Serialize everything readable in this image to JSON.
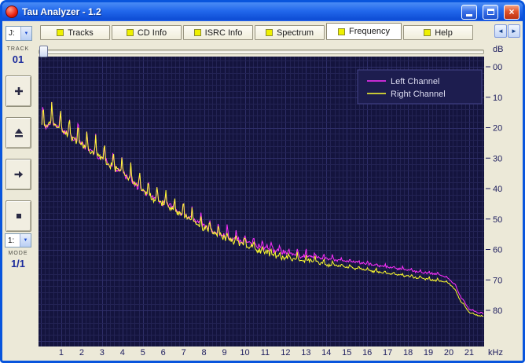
{
  "window": {
    "title": "Tau Analyzer - 1.2",
    "controls": {
      "close_glyph": "×"
    }
  },
  "tab_bar": {
    "tabs": [
      {
        "label": "Tracks",
        "active": false
      },
      {
        "label": "CD Info",
        "active": false
      },
      {
        "label": "ISRC Info",
        "active": false
      },
      {
        "label": "Spectrum",
        "active": false
      },
      {
        "label": "Frequency",
        "active": true
      },
      {
        "label": "Help",
        "active": false
      }
    ],
    "scroll_left_glyph": "◄",
    "scroll_right_glyph": "►"
  },
  "sidebar": {
    "drive_combo_value": "J:",
    "combo_arrow_glyph": "▼",
    "track_caption": "TRACK",
    "track_value": "01",
    "mode_combo_value": "1:",
    "mode_caption": "MODE",
    "mode_value": "1/1"
  },
  "colors": {
    "plot_background": "#14143e",
    "grid_minor": "#232354",
    "grid_major": "#2e2e68",
    "axis_text": "#1c1c5e",
    "left_channel": "#ff30ff",
    "right_channel": "#ffff2e",
    "legend_background": "#1d1d4f",
    "legend_border": "#44448a",
    "legend_text": "#dcdcf0"
  },
  "chart_data": {
    "type": "line",
    "description": "Audio frequency spectrum, level in dB (0 to -80) vs frequency in kHz (0-21.7), spiky decaying curves for left and right channels",
    "x_unit_label": "kHz",
    "y_axis_label": "dB",
    "x_ticks": [
      "1",
      "2",
      "3",
      "4",
      "5",
      "6",
      "7",
      "8",
      "9",
      "10",
      "11",
      "12",
      "13",
      "14",
      "15",
      "16",
      "17",
      "18",
      "19",
      "20",
      "21"
    ],
    "y_ticks": [
      "00",
      "10",
      "20",
      "30",
      "40",
      "50",
      "60",
      "70",
      "80"
    ],
    "xlim": [
      0,
      21.7
    ],
    "ylim_db": [
      -91,
      3
    ],
    "grid": true,
    "legend_position": "top-right",
    "freqs_khz": [
      0.2,
      0.5,
      1.0,
      1.5,
      2.0,
      2.5,
      3.0,
      3.5,
      4.0,
      4.5,
      5.0,
      5.5,
      6.0,
      6.5,
      7.0,
      7.5,
      8.0,
      8.5,
      9.0,
      9.5,
      10.0,
      10.5,
      11.0,
      11.5,
      12.0,
      12.5,
      13.0,
      13.5,
      14.0,
      14.5,
      15.0,
      15.5,
      16.0,
      16.5,
      17.0,
      17.5,
      18.0,
      18.5,
      19.0,
      19.5,
      20.0,
      20.3,
      20.6,
      21.0,
      21.4,
      21.7
    ],
    "series": [
      {
        "name": "Left Channel",
        "color": "#ff30ff",
        "db": [
          -17,
          -16,
          -18,
          -21,
          -23,
          -26,
          -28,
          -31,
          -33,
          -36,
          -39,
          -41,
          -43,
          -45,
          -47,
          -49,
          -51,
          -53,
          -54.5,
          -55.5,
          -56.5,
          -57.5,
          -58.5,
          -59.5,
          -60.5,
          -61,
          -61.5,
          -62,
          -62.5,
          -63,
          -63.5,
          -64,
          -64.5,
          -65,
          -65.5,
          -66,
          -66.5,
          -67,
          -67.5,
          -68,
          -69.5,
          -71.5,
          -75.5,
          -79.5,
          -80.5,
          -81
        ]
      },
      {
        "name": "Right Channel",
        "color": "#ffff2e",
        "db": [
          -17,
          -16,
          -18,
          -21,
          -23,
          -26,
          -28,
          -31,
          -33,
          -36,
          -39,
          -41.5,
          -43.5,
          -45.5,
          -47.5,
          -49.5,
          -51.5,
          -53.5,
          -55,
          -56.5,
          -57.5,
          -59,
          -60,
          -61,
          -62,
          -62.5,
          -63,
          -63.5,
          -64.5,
          -65,
          -65.5,
          -66,
          -66.5,
          -67,
          -67.5,
          -68,
          -68.5,
          -69,
          -69.5,
          -70,
          -71,
          -73,
          -77,
          -80.5,
          -81.5,
          -82
        ]
      }
    ]
  }
}
